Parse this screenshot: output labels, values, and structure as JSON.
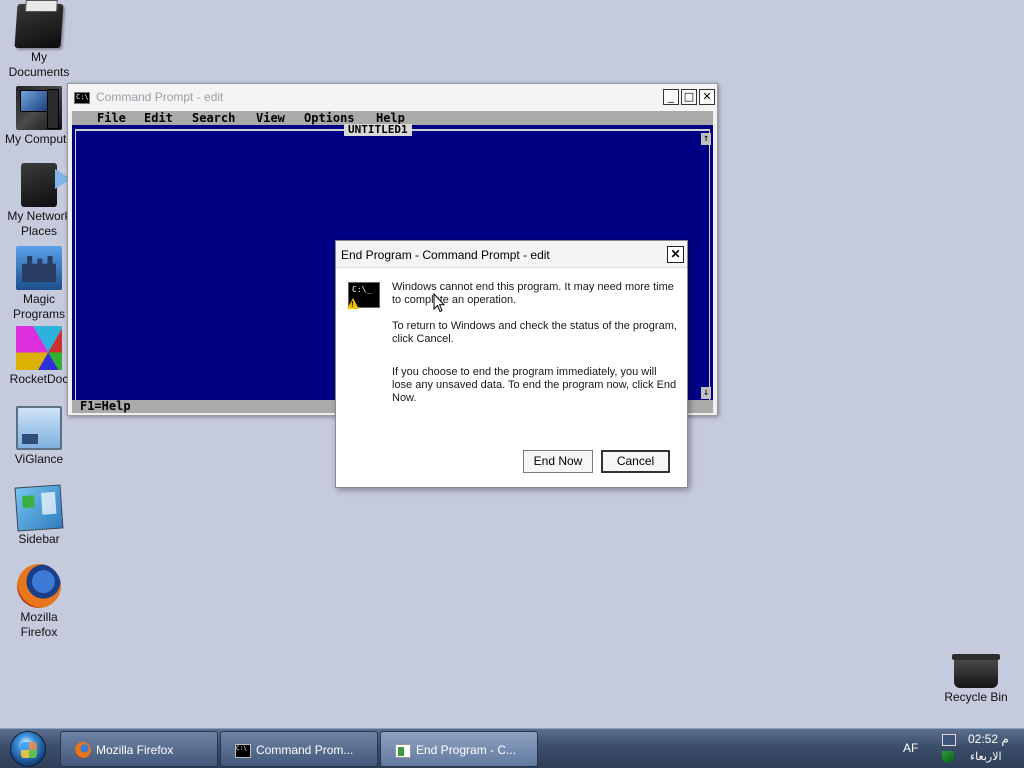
{
  "desktop": {
    "icons": [
      {
        "label": "My\nDocuments",
        "icon": "my-documents-icon"
      },
      {
        "label": "My Compute",
        "icon": "my-computer-icon"
      },
      {
        "label": "My Network\nPlaces",
        "icon": "network-places-icon"
      },
      {
        "label": "Magic\nPrograms",
        "icon": "magic-programs-icon"
      },
      {
        "label": "RocketDoc",
        "icon": "rocketdock-icon"
      },
      {
        "label": "ViGlance",
        "icon": "viglance-icon"
      },
      {
        "label": "Sidebar",
        "icon": "sidebar-icon"
      },
      {
        "label": "Mozilla\nFirefox",
        "icon": "firefox-icon"
      }
    ],
    "recycle_bin": {
      "label": "Recycle Bin",
      "icon": "recycle-bin-icon"
    }
  },
  "cmd_window": {
    "title": "Command Prompt - edit",
    "icon_text": "C:\\",
    "buttons": {
      "minimize": "_",
      "maximize": "□",
      "close": "✕"
    },
    "menu": [
      "File",
      "Edit",
      "Search",
      "View",
      "Options",
      "Help"
    ],
    "document_title": "UNTITLED1",
    "status": "F1=Help",
    "scroll_up": "↑",
    "scroll_down": "↓",
    "colors": {
      "editor_bg": "#000084",
      "menubar_bg": "#aaaaaa"
    }
  },
  "dialog": {
    "title": "End Program - Command Prompt - edit",
    "close": "✕",
    "icon_text": "C:\\_",
    "paragraphs": [
      "Windows cannot end this program. It may need more time to complete an operation.",
      "To return to Windows and check the status of the program, click Cancel.",
      "If you choose to end the program immediately, you will lose any unsaved data. To end the program now, click End Now."
    ],
    "buttons": {
      "end_now": "End Now",
      "cancel": "Cancel"
    }
  },
  "taskbar": {
    "buttons": [
      {
        "label": "Mozilla Firefox",
        "icon": "firefox-icon"
      },
      {
        "label": "Command Prom...",
        "icon": "command-prompt-icon"
      },
      {
        "label": "End Program - C...",
        "icon": "end-program-icon"
      }
    ],
    "language": "AF",
    "clock": {
      "time": "02:52 م",
      "day": "الاربعاء"
    }
  }
}
